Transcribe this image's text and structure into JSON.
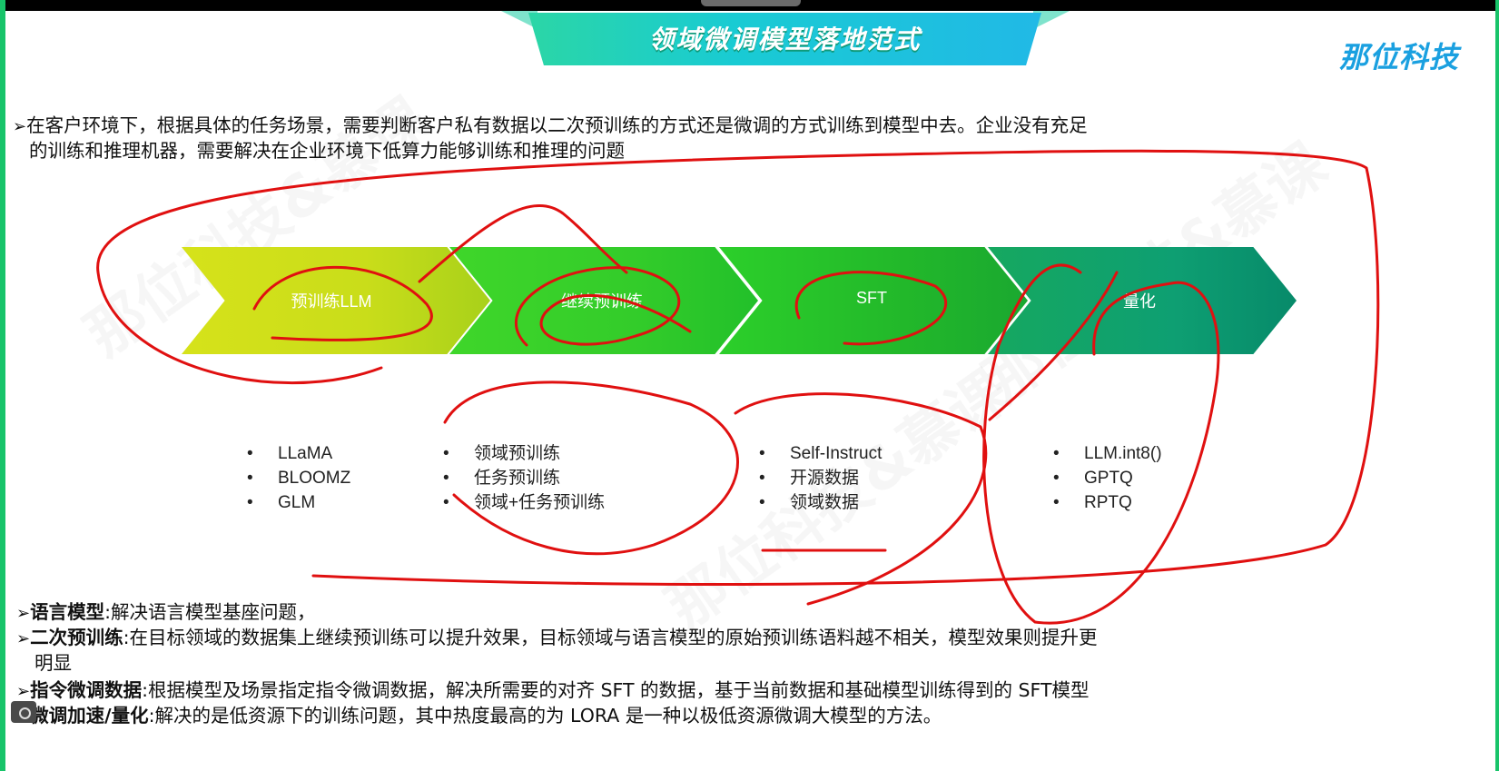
{
  "slide": {
    "title": "领域微调模型落地范式",
    "logo": "那位科技",
    "watermark": "那位科技&慕课",
    "intro": {
      "marker": "➢",
      "line1": "在客户环境下，根据具体的任务场景，需要判断客户私有数据以二次预训练的方式还是微调的方式训练到模型中去。企业没有充足",
      "line2": "的训练和推理机器，需要解决在企业环境下低算力能够训练和推理的问题"
    },
    "stages": [
      {
        "label": "预训练LLM",
        "items": [
          "LLaMA",
          "BLOOMZ",
          "GLM"
        ]
      },
      {
        "label": "继续预训练",
        "items": [
          "领域预训练",
          "任务预训练",
          "领域+任务预训练"
        ]
      },
      {
        "label": "SFT",
        "items": [
          "Self-Instruct",
          "开源数据",
          "领域数据"
        ]
      },
      {
        "label": "量化",
        "items": [
          "LLM.int8()",
          "GPTQ",
          "RPTQ"
        ]
      }
    ],
    "notes": [
      {
        "term": "语言模型",
        "text": ":解决语言模型基座问题，"
      },
      {
        "term": "二次预训练",
        "text": ":在目标领域的数据集上继续预训练可以提升效果，目标领域与语言模型的原始预训练语料越不相关，模型效果则提升更",
        "cont": "明显"
      },
      {
        "term": "指令微调数据",
        "text": ":根据模型及场景指定指令微调数据，解决所需要的对齐 SFT 的数据，基于当前数据和基础模型训练得到的 SFT模型"
      },
      {
        "term": "微调加速/量化",
        "text": ":解决的是低资源下的训练问题，其中热度最高的为 LORA 是一种以极低资源微调大模型的方法。"
      }
    ]
  },
  "colors": {
    "arrow1": "#c9dd1a",
    "arrow2": "#33cc2a",
    "arrow3": "#22b82a",
    "arrow4": "#0e9f72",
    "ink": "#e01010",
    "accent": "#18c46a"
  }
}
